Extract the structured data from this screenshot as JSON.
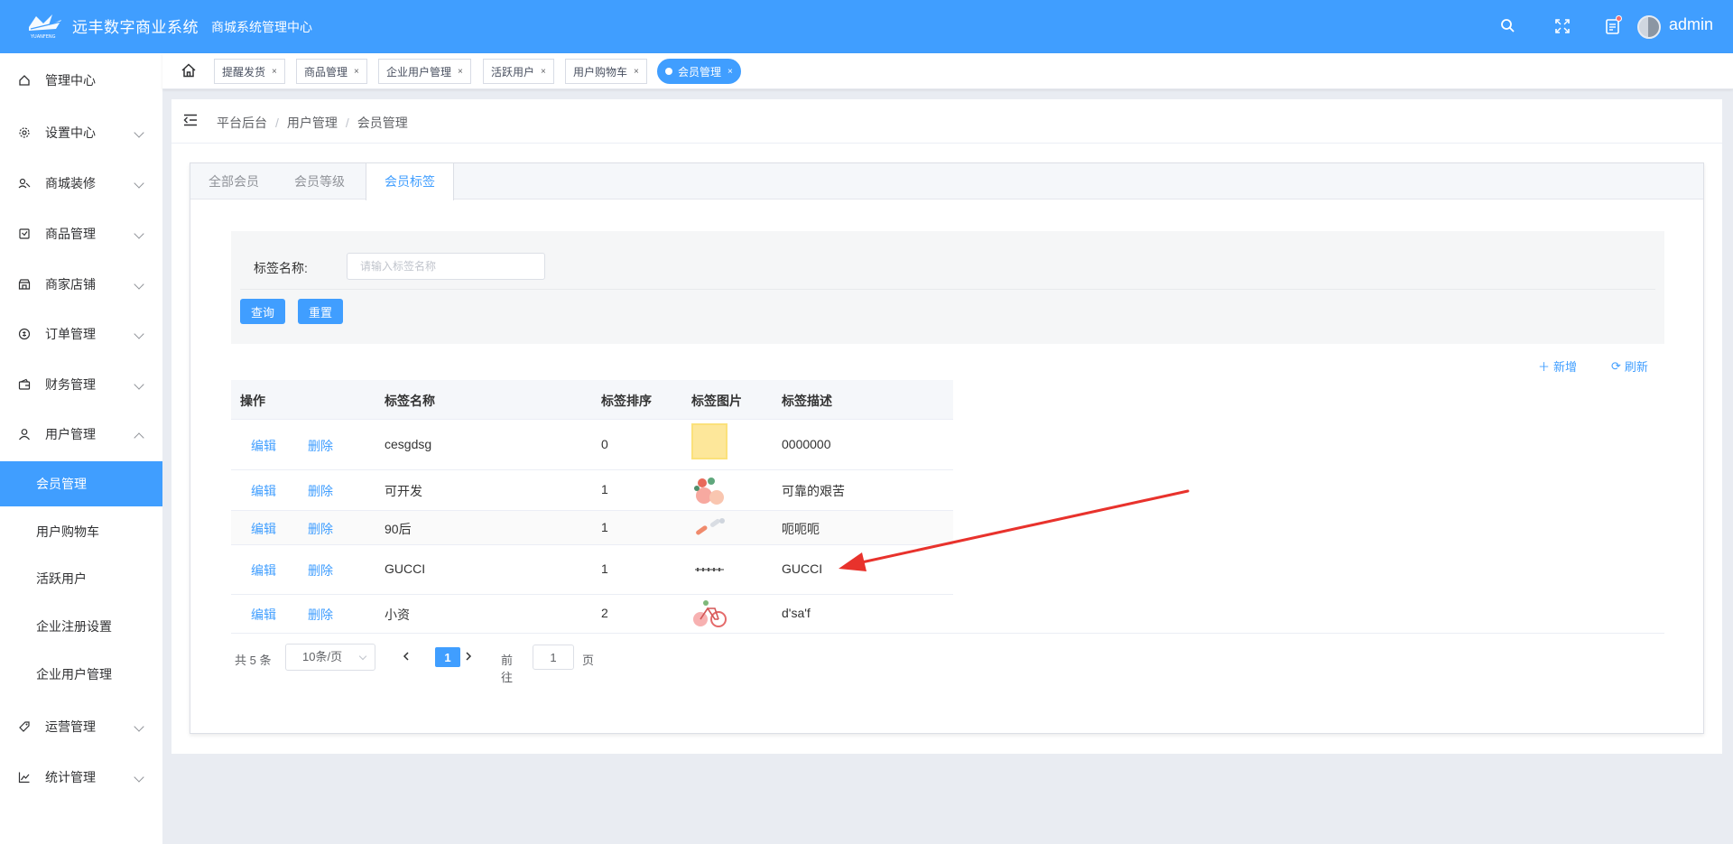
{
  "header": {
    "logo_caption": "YUANFENG",
    "app_title": "远丰数字商业系统",
    "sub_title": "商城系统管理中心",
    "username": "admin",
    "icons": [
      "search-icon",
      "fullscreen-icon",
      "message-icon"
    ],
    "color": "#409eff"
  },
  "sidebar": {
    "items": [
      {
        "label": "管理中心",
        "icon": "home-icon"
      },
      {
        "label": "设置中心",
        "icon": "gear-icon"
      },
      {
        "label": "商城装修",
        "icon": "decorate-icon"
      },
      {
        "label": "商品管理",
        "icon": "goods-icon"
      },
      {
        "label": "商家店铺",
        "icon": "shop-icon"
      },
      {
        "label": "订单管理",
        "icon": "order-icon"
      },
      {
        "label": "财务管理",
        "icon": "finance-icon"
      },
      {
        "label": "用户管理",
        "icon": "user-icon"
      },
      {
        "label": "运营管理",
        "icon": "tag-icon"
      },
      {
        "label": "统计管理",
        "icon": "chart-icon"
      }
    ],
    "sub_items": [
      {
        "label": "会员管理",
        "active": true
      },
      {
        "label": "用户购物车"
      },
      {
        "label": "活跃用户"
      },
      {
        "label": "企业注册设置"
      },
      {
        "label": "企业用户管理"
      }
    ]
  },
  "tabs": [
    {
      "label": "提醒发货"
    },
    {
      "label": "商品管理"
    },
    {
      "label": "企业用户管理"
    },
    {
      "label": "活跃用户"
    },
    {
      "label": "用户购物车"
    },
    {
      "label": "会员管理",
      "active": true
    }
  ],
  "tab_close": "×",
  "breadcrumb": {
    "items": [
      "平台后台",
      "用户管理",
      "会员管理"
    ],
    "separator": "/"
  },
  "card_tabs": [
    {
      "label": "全部会员"
    },
    {
      "label": "会员等级"
    },
    {
      "label": "会员标签",
      "active": true
    }
  ],
  "search": {
    "label": "标签名称:",
    "placeholder": "请输入标签名称",
    "query_label": "查询",
    "reset_label": "重置"
  },
  "toolbar": {
    "add_label": "新增",
    "refresh_label": "刷新"
  },
  "table": {
    "columns": [
      "操作",
      "标签名称",
      "标签排序",
      "标签图片",
      "标签描述"
    ],
    "edit_label": "编辑",
    "delete_label": "删除",
    "rows": [
      {
        "name": "cesgdsg",
        "sort": "0",
        "image": "yellow-square-image",
        "desc": "0000000"
      },
      {
        "name": "可开发",
        "sort": "1",
        "image": "flowers-image",
        "desc": "可靠的艰苦"
      },
      {
        "name": "90后",
        "sort": "1",
        "image": "pills-image",
        "desc": "呃呃呃"
      },
      {
        "name": "GUCCI",
        "sort": "1",
        "image": "gucci-logo-image",
        "desc": "GUCCI"
      },
      {
        "name": "小资",
        "sort": "2",
        "image": "bicycle-image",
        "desc": "d'sa'f"
      }
    ]
  },
  "pagination": {
    "total": "共 5 条",
    "page_size": "10条/页",
    "current_page": "1",
    "goto_label": "前往",
    "goto_value": "1",
    "page_unit": "页"
  },
  "annotation": {
    "type": "red-arrow",
    "color": "#e8322c",
    "points_to": "GUCCI row"
  }
}
